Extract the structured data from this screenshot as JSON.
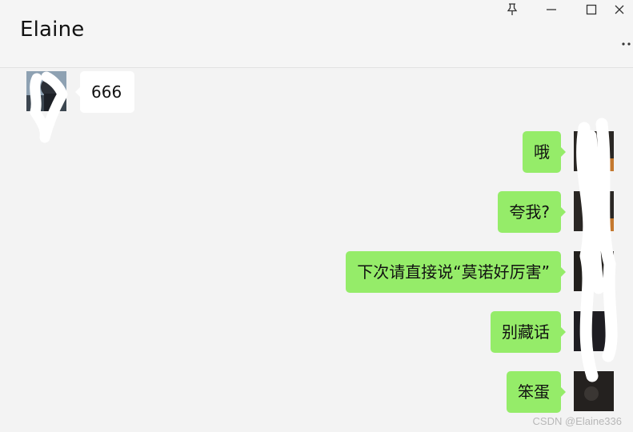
{
  "chat": {
    "title": "Elaine",
    "messages": [
      {
        "side": "in",
        "text": "666"
      },
      {
        "side": "out",
        "text": "哦"
      },
      {
        "side": "out",
        "text": "夸我?"
      },
      {
        "side": "out",
        "text": "下次请直接说“莫诺好厉害”"
      },
      {
        "side": "out",
        "text": "别藏话"
      },
      {
        "side": "out",
        "text": "笨蛋"
      }
    ]
  },
  "window_controls": [
    "pin-icon",
    "minimize-icon",
    "maximize-icon",
    "close-icon"
  ],
  "more_icon": "more-dots-icon",
  "watermark": "CSDN @Elaine336",
  "colors": {
    "background": "#f3f3f3",
    "header": "#f5f5f5",
    "incoming_bubble": "#ffffff",
    "outgoing_bubble": "#95ec69",
    "text": "#111111",
    "icons": "#333333"
  }
}
